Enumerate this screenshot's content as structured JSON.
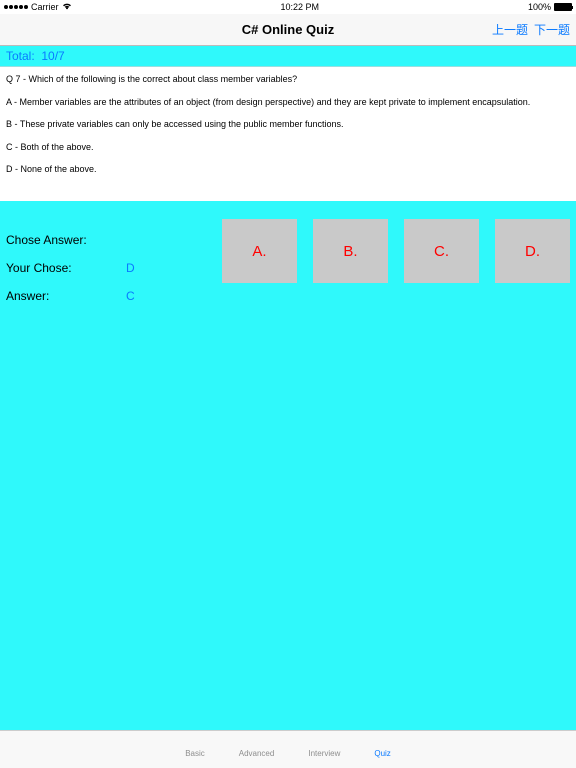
{
  "status_bar": {
    "carrier": "Carrier",
    "wifi_icon": "wifi-icon",
    "time": "10:22 PM",
    "battery_pct": "100%"
  },
  "nav": {
    "title": "C# Online Quiz",
    "prev": "上一题",
    "next": "下一题"
  },
  "total": {
    "label": "Total:",
    "value": "10/7"
  },
  "question": {
    "prompt": "Q 7 - Which of the following is the correct about class member variables?",
    "opt_a": "A - Member variables are the attributes of an object (from design perspective) and they are kept private to implement encapsulation.",
    "opt_b": "B - These private variables can only be accessed using the public member functions.",
    "opt_c": "C - Both of the above.",
    "opt_d": "D - None of the above."
  },
  "choose": {
    "chose_answer_label": "Chose Answer:",
    "your_chose_label": "Your Chose:",
    "your_chose_value": "D",
    "answer_label": "Answer:",
    "answer_value": "C"
  },
  "buttons": {
    "a": "A.",
    "b": "B.",
    "c": "C.",
    "d": "D."
  },
  "tabs": {
    "basic": "Basic",
    "advanced": "Advanced",
    "interview": "Interview",
    "quiz": "Quiz"
  }
}
